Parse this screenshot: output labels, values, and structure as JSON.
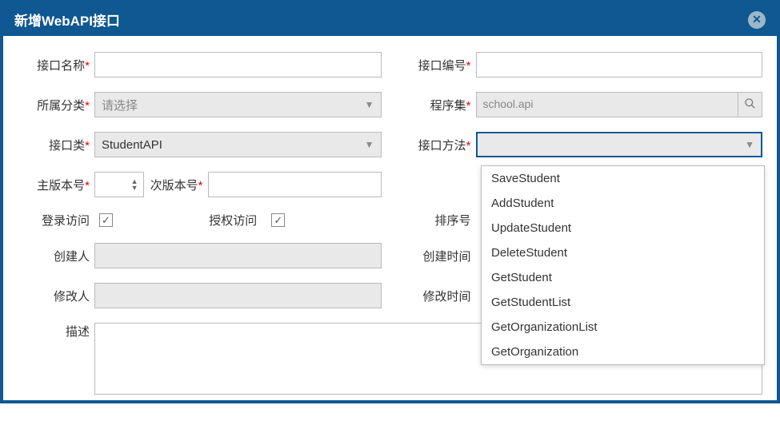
{
  "dialog": {
    "title": "新增WebAPI接口"
  },
  "labels": {
    "api_name": "接口名称",
    "api_code": "接口编号",
    "category": "所属分类",
    "assembly": "程序集",
    "api_class": "接口类",
    "api_method": "接口方法",
    "major_ver": "主版本号",
    "minor_ver": "次版本号",
    "login_access": "登录访问",
    "auth_access": "授权访问",
    "sort_no": "排序号",
    "creator": "创建人",
    "create_time": "创建时间",
    "modifier": "修改人",
    "modify_time": "修改时间",
    "desc": "描述"
  },
  "values": {
    "category_placeholder": "请选择",
    "assembly_value": "school.api",
    "api_class_value": "StudentAPI",
    "api_method_value": "",
    "login_access_checked": true,
    "auth_access_checked": true
  },
  "dropdown_options": [
    "SaveStudent",
    "AddStudent",
    "UpdateStudent",
    "DeleteStudent",
    "GetStudent",
    "GetStudentList",
    "GetOrganizationList",
    "GetOrganization"
  ],
  "icons": {
    "close": "✕",
    "caret_down": "▼",
    "caret_up": "▲",
    "check": "✓",
    "search": "🔍"
  }
}
